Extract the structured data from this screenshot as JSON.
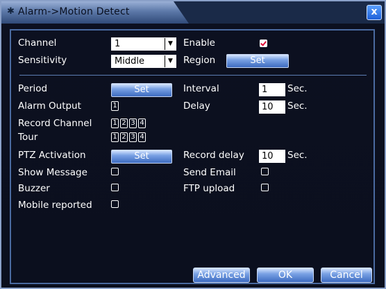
{
  "window": {
    "title": "Alarm->Motion Detect",
    "close_label": "x",
    "title_icon": "gear-icon"
  },
  "form": {
    "channel_label": "Channel",
    "channel_value": "1",
    "enable_label": "Enable",
    "enable_checked": true,
    "sensitivity_label": "Sensitivity",
    "sensitivity_value": "Middle",
    "region_label": "Region",
    "region_button": "Set",
    "period_label": "Period",
    "period_button": "Set",
    "interval_label": "Interval",
    "interval_value": "1",
    "interval_unit": "Sec.",
    "alarm_output_label": "Alarm Output",
    "alarm_output_chips": [
      "1"
    ],
    "delay_label": "Delay",
    "delay_value": "10",
    "delay_unit": "Sec.",
    "record_channel_label": "Record Channel",
    "record_channel_chips": [
      "1",
      "2",
      "3",
      "4"
    ],
    "tour_label": "Tour",
    "tour_chips": [
      "1",
      "2",
      "3",
      "4"
    ],
    "ptz_label": "PTZ Activation",
    "ptz_button": "Set",
    "record_delay_label": "Record delay",
    "record_delay_value": "10",
    "record_delay_unit": "Sec.",
    "show_message_label": "Show Message",
    "send_email_label": "Send Email",
    "buzzer_label": "Buzzer",
    "ftp_upload_label": "FTP upload",
    "mobile_reported_label": "Mobile reported"
  },
  "footer": {
    "advanced": "Advanced",
    "ok": "OK",
    "cancel": "Cancel"
  },
  "colors": {
    "background": "#0b0f1e",
    "panel_border": "#4a6aa0",
    "button_top": "#d8e6ff",
    "button_bottom": "#3d6bc0",
    "check_mark": "#e0103a"
  }
}
